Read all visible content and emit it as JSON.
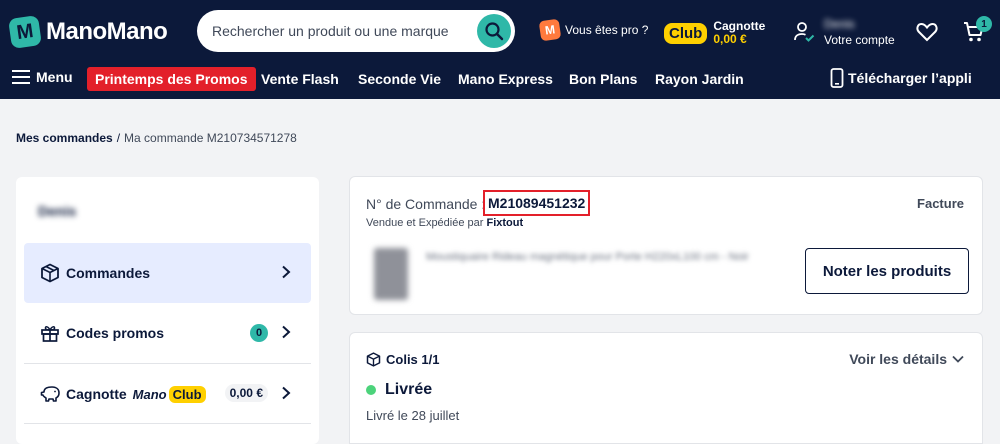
{
  "header": {
    "logo_badge": "M",
    "logo_text": "ManoMano",
    "search_placeholder": "Rechercher un produit ou une marque",
    "pro_badge": "M",
    "pro_label": "Vous êtes pro ?",
    "club_badge": "Club",
    "club_label": "Cagnotte",
    "club_amount": "0,00 €",
    "account_name": "Denis",
    "account_label": "Votre compte",
    "cart_count": "1"
  },
  "nav": {
    "menu": "Menu",
    "promo": "Printemps des Promos",
    "items": [
      "Vente Flash",
      "Seconde Vie",
      "Mano Express",
      "Bon Plans",
      "Rayon Jardin"
    ],
    "app": "Télécharger l’appli"
  },
  "breadcrumb": {
    "link": "Mes commandes",
    "separator": "/",
    "current": "Ma commande M210734571278"
  },
  "sidebar": {
    "user_name": "Denis",
    "items": [
      {
        "label": "Commandes",
        "icon": "box-icon"
      },
      {
        "label": "Codes promos",
        "icon": "gift-icon",
        "badge": "0"
      },
      {
        "label": "Cagnotte",
        "icon": "piggy-bank-icon",
        "brand_mano": "Mano",
        "brand_club": "Club",
        "amount": "0,00 €"
      }
    ]
  },
  "order": {
    "label": "N° de Commande :",
    "number": "M21089451232",
    "invoice": "Facture",
    "sold_by_prefix": "Vendue et Expédiée par",
    "seller": "Fixtout",
    "product_name": "Moustiquaire Rideau magnétique pour Porte H220xL100 cm - Noir",
    "rate_button": "Noter les produits"
  },
  "parcel": {
    "title": "Colis 1/1",
    "details_link": "Voir les détails",
    "status": "Livrée",
    "delivered_date": "Livré le 28 juillet"
  },
  "colors": {
    "navy": "#0c193a",
    "teal": "#2fb8a8",
    "promo_red": "#e3202a",
    "club_yellow": "#ffd000",
    "status_green": "#4cd37b"
  }
}
